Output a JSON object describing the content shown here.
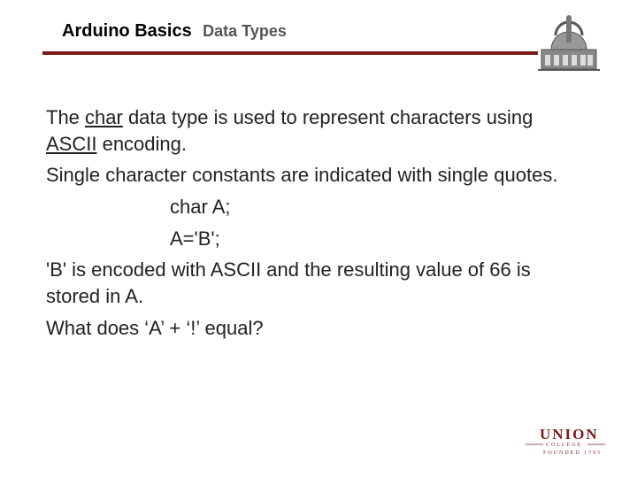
{
  "header": {
    "title_main": "Arduino Basics",
    "title_sub": "Data Types"
  },
  "body": {
    "p1_a": "The ",
    "p1_char": "char",
    "p1_b": " data type is used to represent characters using ",
    "p1_ascii": "ASCII",
    "p1_c": " encoding.",
    "p2": "Single character constants are indicated with single quotes.",
    "code1": "char A;",
    "code2": "A='B';",
    "p3": "'B' is encoded with ASCII and the resulting value of 66 is stored in A.",
    "p4": "What does ‘A’ + ‘!’ equal?"
  },
  "logo": {
    "org": "UNION",
    "subline": "FOUNDED 1795",
    "college": "COLLEGE"
  }
}
